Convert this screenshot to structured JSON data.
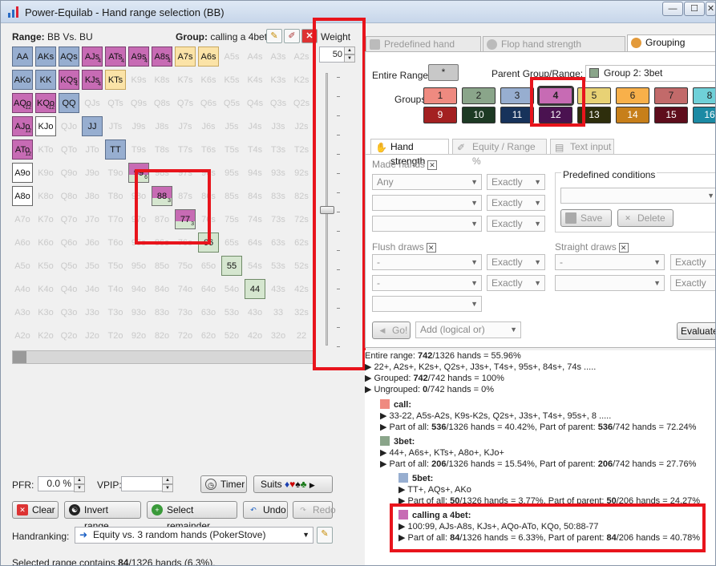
{
  "window": {
    "title": "Power-Equilab - Hand range selection (BB)",
    "minimize": "—",
    "maximize": "☐",
    "close": "✕"
  },
  "left": {
    "range_label": "Range:",
    "range_value": "BB Vs. BU",
    "group_label": "Group:",
    "group_value": "calling a 4bet",
    "weight_label": "Weight",
    "weight_value": "50",
    "pfr_label": "PFR:",
    "pfr_value": "0.0 %",
    "vpip_label": "VPIP:",
    "vpip_value": "",
    "timer_label": "Timer",
    "suits_label": "Suits",
    "clear_label": "Clear",
    "invert_label": "Invert range",
    "select_remainder_label": "Select remainder",
    "undo_label": "Undo",
    "redo_label": "Redo",
    "handranking_label": "Handranking:",
    "handranking_value": "Equity vs. 3 random hands (PokerStove)",
    "status_prefix": "Selected range contains ",
    "status_count": "84",
    "status_suffix": "/1326 hands (6.3%)."
  },
  "grid": [
    [
      "AA",
      "AKs",
      "AQs",
      "AJs",
      "ATs",
      "A9s",
      "A8s",
      "A7s",
      "A6s",
      "A5s",
      "A4s",
      "A3s",
      "A2s"
    ],
    [
      "AKo",
      "KK",
      "KQs",
      "KJs",
      "KTs",
      "K9s",
      "K8s",
      "K7s",
      "K6s",
      "K5s",
      "K4s",
      "K3s",
      "K2s"
    ],
    [
      "AQo",
      "KQo",
      "QQ",
      "QJs",
      "QTs",
      "Q9s",
      "Q8s",
      "Q7s",
      "Q6s",
      "Q5s",
      "Q4s",
      "Q3s",
      "Q2s"
    ],
    [
      "AJo",
      "KJo",
      "QJo",
      "JJ",
      "JTs",
      "J9s",
      "J8s",
      "J7s",
      "J6s",
      "J5s",
      "J4s",
      "J3s",
      "J2s"
    ],
    [
      "ATo",
      "KTo",
      "QTo",
      "JTo",
      "TT",
      "T9s",
      "T8s",
      "T7s",
      "T6s",
      "T5s",
      "T4s",
      "T3s",
      "T2s"
    ],
    [
      "A9o",
      "K9o",
      "Q9o",
      "J9o",
      "T9o",
      "99",
      "98s",
      "97s",
      "96s",
      "95s",
      "94s",
      "93s",
      "92s"
    ],
    [
      "A8o",
      "K8o",
      "Q8o",
      "J8o",
      "T8o",
      "98o",
      "88",
      "87s",
      "86s",
      "85s",
      "84s",
      "83s",
      "82s"
    ],
    [
      "A7o",
      "K7o",
      "Q7o",
      "J7o",
      "T7o",
      "97o",
      "87o",
      "77",
      "76s",
      "75s",
      "74s",
      "73s",
      "72s"
    ],
    [
      "A6o",
      "K6o",
      "Q6o",
      "J6o",
      "T6o",
      "96o",
      "86o",
      "76o",
      "66",
      "65s",
      "64s",
      "63s",
      "62s"
    ],
    [
      "A5o",
      "K5o",
      "Q5o",
      "J5o",
      "T5o",
      "95o",
      "85o",
      "75o",
      "65o",
      "55",
      "54s",
      "53s",
      "52s"
    ],
    [
      "A4o",
      "K4o",
      "Q4o",
      "J4o",
      "T4o",
      "94o",
      "84o",
      "74o",
      "64o",
      "54o",
      "44",
      "43s",
      "42s"
    ],
    [
      "A3o",
      "K3o",
      "Q3o",
      "J3o",
      "T3o",
      "93o",
      "83o",
      "73o",
      "63o",
      "53o",
      "43o",
      "33",
      "32s"
    ],
    [
      "A2o",
      "K2o",
      "Q2o",
      "J2o",
      "T2o",
      "92o",
      "82o",
      "72o",
      "62o",
      "52o",
      "42o",
      "32o",
      "22"
    ]
  ],
  "grid_subs": {
    "AJs": "4",
    "ATs": "4",
    "A9s": "4",
    "A8s": "4",
    "KQs": "4",
    "KJs": "4",
    "AQo": "12",
    "KQo": "12",
    "AJo": "12",
    "ATo": "12",
    "99": "6",
    "88": "3",
    "77": "3"
  },
  "right": {
    "tabs": [
      "Predefined hand ranges",
      "Flop hand strength distribution",
      "Grouping options"
    ],
    "entire_range_label": "Entire Range:",
    "entire_range_btn": "*",
    "parent_label": "Parent Group/Range:",
    "parent_value": "Group 2: 3bet",
    "groups_label": "Groups:",
    "groups": [
      {
        "n": "1",
        "c": "#ef8a80"
      },
      {
        "n": "2",
        "c": "#8aa58a"
      },
      {
        "n": "3",
        "c": "#97aed0"
      },
      {
        "n": "4",
        "c": "#c76bb4"
      },
      {
        "n": "5",
        "c": "#e8d275"
      },
      {
        "n": "6",
        "c": "#f8b04a"
      },
      {
        "n": "7",
        "c": "#c26a6a"
      },
      {
        "n": "8",
        "c": "#6fd0d8"
      },
      {
        "n": "9",
        "c": "#a32021"
      },
      {
        "n": "10",
        "c": "#1d3a24"
      },
      {
        "n": "11",
        "c": "#17335b"
      },
      {
        "n": "12",
        "c": "#4a1250"
      },
      {
        "n": "13",
        "c": "#2e2e0c"
      },
      {
        "n": "14",
        "c": "#c77f1a"
      },
      {
        "n": "15",
        "c": "#5e0d1c"
      },
      {
        "n": "16",
        "c": "#1c8aa4"
      }
    ],
    "subtabs": [
      "Hand strength",
      "Equity / Range %",
      "Text input"
    ],
    "made_hands": "Made hands",
    "any": "Any",
    "exactly": "Exactly",
    "predefined_conditions": "Predefined conditions",
    "save": "Save",
    "delete": "Delete",
    "flush_draws": "Flush draws",
    "straight_draws": "Straight draws",
    "dash": "-",
    "go": "Go!",
    "add_logical": "Add (logical or)",
    "evaluate": "Evaluate"
  },
  "tree": {
    "l1a": "Entire range: ",
    "l1b": "742",
    "l1c": "/1326 hands = 55.96%",
    "l2": "22+, A2s+, K2s+, Q2s+, J3s+, T4s+, 95s+, 84s+, 74s .....",
    "l3a": "Grouped: ",
    "l3b": "742",
    "l3c": "/742 hands = 100%",
    "l4a": "Ungrouped: ",
    "l4b": "0",
    "l4c": "/742 hands = 0%",
    "call_name": "call:",
    "call_l1": "33-22, A5s-A2s, K9s-K2s, Q2s+, J3s+, T4s+, 95s+, 8 .....",
    "call_l2a": "Part of all: ",
    "call_l2b": "536",
    "call_l2c": "/1326 hands = 40.42%, Part of parent: ",
    "call_l2d": "536",
    "call_l2e": "/742 hands = 72.24%",
    "bet3_name": "3bet:",
    "bet3_l1": "44+, A6s+, KTs+, A8o+, KJo+",
    "bet3_l2a": "Part of all: ",
    "bet3_l2b": "206",
    "bet3_l2c": "/1326 hands = 15.54%, Part of parent: ",
    "bet3_l2d": "206",
    "bet3_l2e": "/742 hands = 27.76%",
    "bet5_name": "5bet:",
    "bet5_l1": "TT+, AQs+, AKo",
    "bet5_l2a": "Part of all: ",
    "bet5_l2b": "50",
    "bet5_l2c": "/1326 hands = 3.77%, Part of parent: ",
    "bet5_l2d": "50",
    "bet5_l2e": "/206 hands = 24.27%",
    "c4_name": "calling a 4bet:",
    "c4_l1": "100:99, AJs-A8s, KJs+, AQo-ATo, KQo, 50:88-77",
    "c4_l2a": "Part of all: ",
    "c4_l2b": "84",
    "c4_l2c": "/1326 hands = 6.33%, Part of parent: ",
    "c4_l2d": "84",
    "c4_l2e": "/206 hands = 40.78%"
  }
}
